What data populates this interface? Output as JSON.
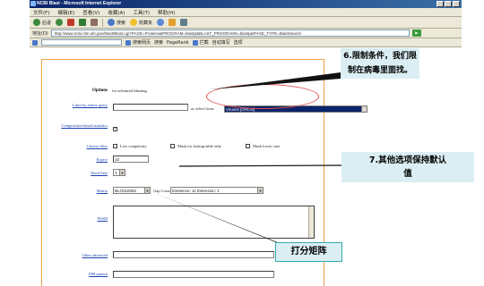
{
  "browser": {
    "title": "NCBI Blast - Microsoft Internet Explorer",
    "menu": [
      "文件(F)",
      "编辑(E)",
      "查看(V)",
      "收藏(A)",
      "工具(T)",
      "帮助(H)"
    ],
    "toolbar": {
      "back": "后退",
      "search": "搜索",
      "favorites": "收藏夹"
    },
    "address_label": "地址(D)",
    "address_value": "http://www.ncbi.nlm.nih.gov/blast/Blast.cgi?PAGE=Proteins&PROGRAM=blastp&BLAST_PROGRAMS=blastp&PAGE_TYPE=BlastSearch",
    "search_buttons": [
      "搜索网页",
      "搜索",
      "PageRank",
      "拦截",
      "自动填写",
      "选项"
    ]
  },
  "form": {
    "options_heading": "Options",
    "options_desc": "for advanced blasting",
    "limit_label": "Limit by entrez query",
    "or_select": "or select from:",
    "organism_select": "Viruses [ORGN]",
    "composition_label": "Composition-based statistics",
    "composition_check": "✓",
    "choose_filter_label": "Choose filter",
    "filter_options": [
      "Low complexity",
      "Mask for lookup table only",
      "Mask lower case"
    ],
    "expect_label": "Expect",
    "expect_value": "10",
    "word_size_label": "Word Size",
    "word_size_value": "3",
    "matrix_label": "Matrix",
    "matrix_value": "BLOSUM62",
    "gap_costs_label": "Gap Costs",
    "gap_costs_value": "Existence: 11 Extension: 1",
    "pssm_label": "PSSM",
    "other_advanced_label": "Other advanced",
    "phi_pattern_label": "PHI pattern"
  },
  "callouts": {
    "limit": [
      "6.限制条件，我们限",
      "制在病毒里面找。"
    ],
    "other_options": [
      "7.其他选项保持默认",
      "值"
    ],
    "matrix": "打分矩阵"
  }
}
